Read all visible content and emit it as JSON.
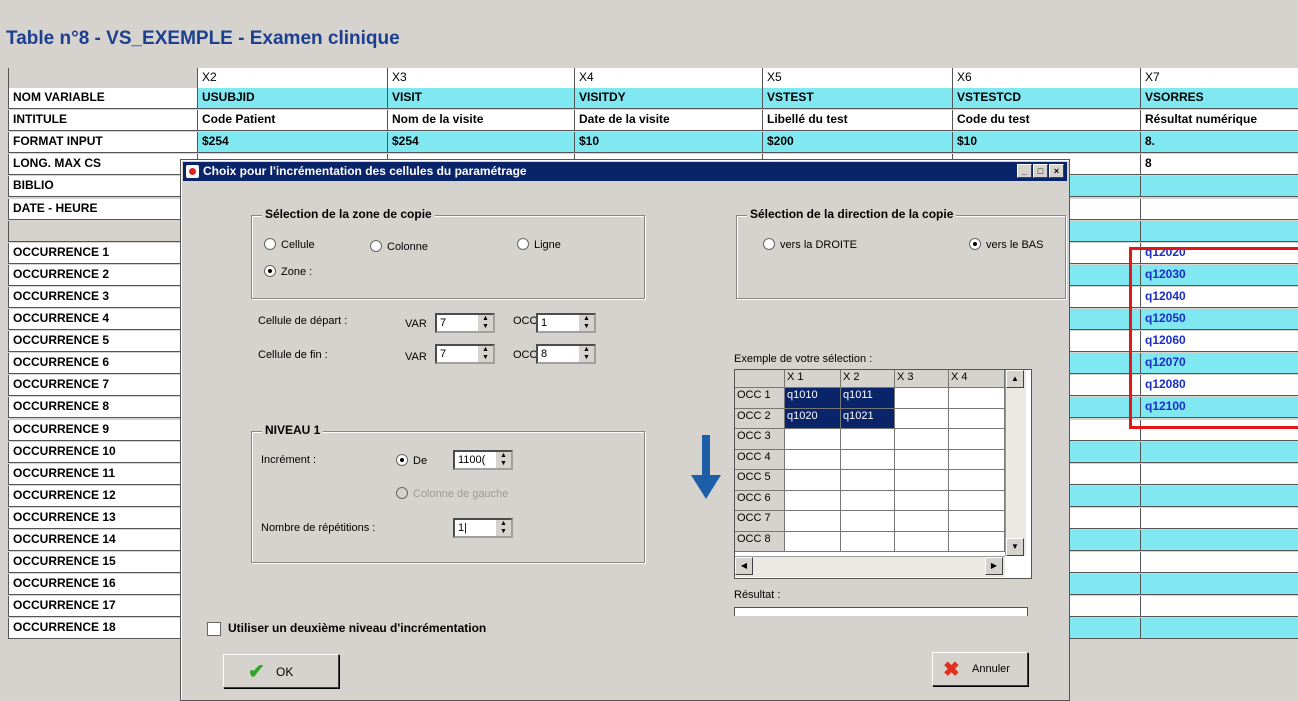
{
  "page_title": "Table n°8 - VS_EXEMPLE - Examen clinique",
  "table": {
    "col_headers": [
      "X2",
      "X3",
      "X4",
      "X5",
      "X6",
      "X7"
    ],
    "rows": [
      {
        "label": "NOM VARIABLE",
        "values": [
          "USUBJID",
          "VISIT",
          "VISITDY",
          "VSTEST",
          "VSTESTCD",
          "VSORRES"
        ]
      },
      {
        "label": "INTITULE",
        "values": [
          "Code Patient",
          "Nom de la visite",
          "Date de la visite",
          "Libellé du test",
          "Code du test",
          "Résultat numérique"
        ]
      },
      {
        "label": "FORMAT INPUT",
        "values": [
          "$254",
          "$254",
          "$10",
          "$200",
          "$10",
          "8."
        ]
      },
      {
        "label": "LONG. MAX CS",
        "values": [
          "",
          "",
          "",
          "",
          "",
          "8"
        ]
      },
      {
        "label": "BIBLIO",
        "values": [
          "",
          "",
          "",
          "",
          "",
          ""
        ]
      },
      {
        "label": "DATE - HEURE",
        "values": [
          "",
          "",
          "",
          "",
          "",
          ""
        ]
      },
      {
        "label": "",
        "values": [
          "",
          "",
          "",
          "",
          "",
          ""
        ]
      },
      {
        "label": "OCCURRENCE 1",
        "values": [
          "",
          "",
          "",
          "",
          "",
          "q12020"
        ]
      },
      {
        "label": "OCCURRENCE 2",
        "values": [
          "",
          "",
          "",
          "",
          "",
          "q12030"
        ]
      },
      {
        "label": "OCCURRENCE 3",
        "values": [
          "",
          "",
          "",
          "",
          "",
          "q12040"
        ]
      },
      {
        "label": "OCCURRENCE 4",
        "values": [
          "",
          "",
          "",
          "",
          "",
          "q12050"
        ]
      },
      {
        "label": "OCCURRENCE 5",
        "values": [
          "",
          "",
          "",
          "",
          "",
          "q12060"
        ]
      },
      {
        "label": "OCCURRENCE 6",
        "values": [
          "",
          "",
          "",
          "",
          "",
          "q12070"
        ]
      },
      {
        "label": "OCCURRENCE 7",
        "values": [
          "",
          "",
          "",
          "",
          "",
          "q12080"
        ]
      },
      {
        "label": "OCCURRENCE 8",
        "values": [
          "",
          "",
          "",
          "",
          "",
          "q12100"
        ]
      },
      {
        "label": "OCCURRENCE 9",
        "values": [
          "",
          "",
          "",
          "",
          "",
          ""
        ]
      },
      {
        "label": "OCCURRENCE 10",
        "values": [
          "",
          "",
          "",
          "",
          "",
          ""
        ]
      },
      {
        "label": "OCCURRENCE 11",
        "values": [
          "",
          "",
          "",
          "",
          "",
          ""
        ]
      },
      {
        "label": "OCCURRENCE 12",
        "values": [
          "",
          "",
          "",
          "",
          "",
          ""
        ]
      },
      {
        "label": "OCCURRENCE 13",
        "values": [
          "",
          "",
          "",
          "",
          "",
          ""
        ]
      },
      {
        "label": "OCCURRENCE 14",
        "values": [
          "",
          "",
          "",
          "",
          "",
          ""
        ]
      },
      {
        "label": "OCCURRENCE 15",
        "values": [
          "",
          "",
          "",
          "",
          "",
          ""
        ]
      },
      {
        "label": "OCCURRENCE 16",
        "values": [
          "",
          "",
          "",
          "",
          "",
          ""
        ]
      },
      {
        "label": "OCCURRENCE 17",
        "values": [
          "",
          "",
          "",
          "",
          "",
          ""
        ]
      },
      {
        "label": "OCCURRENCE 18",
        "values": [
          "",
          "",
          "",
          "",
          "",
          ""
        ]
      }
    ]
  },
  "dialog": {
    "title": "Choix pour l'incrémentation des cellules du paramétrage",
    "window_buttons": [
      "_",
      "□",
      "×"
    ],
    "zone": {
      "title": "Sélection de la zone de copie",
      "options": [
        "Cellule",
        "Colonne",
        "Ligne",
        "Zone :"
      ],
      "selected": "Zone :",
      "start_label": "Cellule de départ :",
      "end_label": "Cellule de fin :",
      "var_label": "VAR",
      "occ_label": "OCC",
      "start_var": "7",
      "start_occ": "1",
      "end_var": "7",
      "end_occ": "8"
    },
    "direction": {
      "title": "Sélection de la direction de la copie",
      "options": [
        "vers la DROITE",
        "vers le BAS"
      ],
      "selected": "vers le BAS"
    },
    "niveau": {
      "title": "NIVEAU 1",
      "increment_label": "Incrément :",
      "de_label": "De",
      "de_value": "1100(",
      "colonne_gauche": "Colonne de gauche",
      "repetitions_label": "Nombre de répétitions :",
      "repetitions_value": "1|"
    },
    "example": {
      "label": "Exemple de votre sélection :",
      "cols": [
        "X 1",
        "X 2",
        "X 3",
        "X 4"
      ],
      "rows": [
        {
          "occ": "OCC 1",
          "vals": [
            "q1010",
            "q1011",
            "",
            ""
          ]
        },
        {
          "occ": "OCC 2",
          "vals": [
            "q1020",
            "q1021",
            "",
            ""
          ]
        },
        {
          "occ": "OCC 3",
          "vals": [
            "",
            "",
            "",
            ""
          ]
        },
        {
          "occ": "OCC 4",
          "vals": [
            "",
            "",
            "",
            ""
          ]
        },
        {
          "occ": "OCC 5",
          "vals": [
            "",
            "",
            "",
            ""
          ]
        },
        {
          "occ": "OCC 6",
          "vals": [
            "",
            "",
            "",
            ""
          ]
        },
        {
          "occ": "OCC 7",
          "vals": [
            "",
            "",
            "",
            ""
          ]
        },
        {
          "occ": "OCC 8",
          "vals": [
            "",
            "",
            "",
            ""
          ]
        }
      ]
    },
    "result_label": "Résultat :",
    "second_level_label": "Utiliser un deuxième niveau d'incrémentation",
    "ok_label": "OK",
    "cancel_label": "Annuler",
    "colors": {
      "titlebar": "#0a246a",
      "cyan": "#7fe8f1",
      "highlight_box": "#e21818",
      "arrow": "#1c5ea8"
    }
  }
}
